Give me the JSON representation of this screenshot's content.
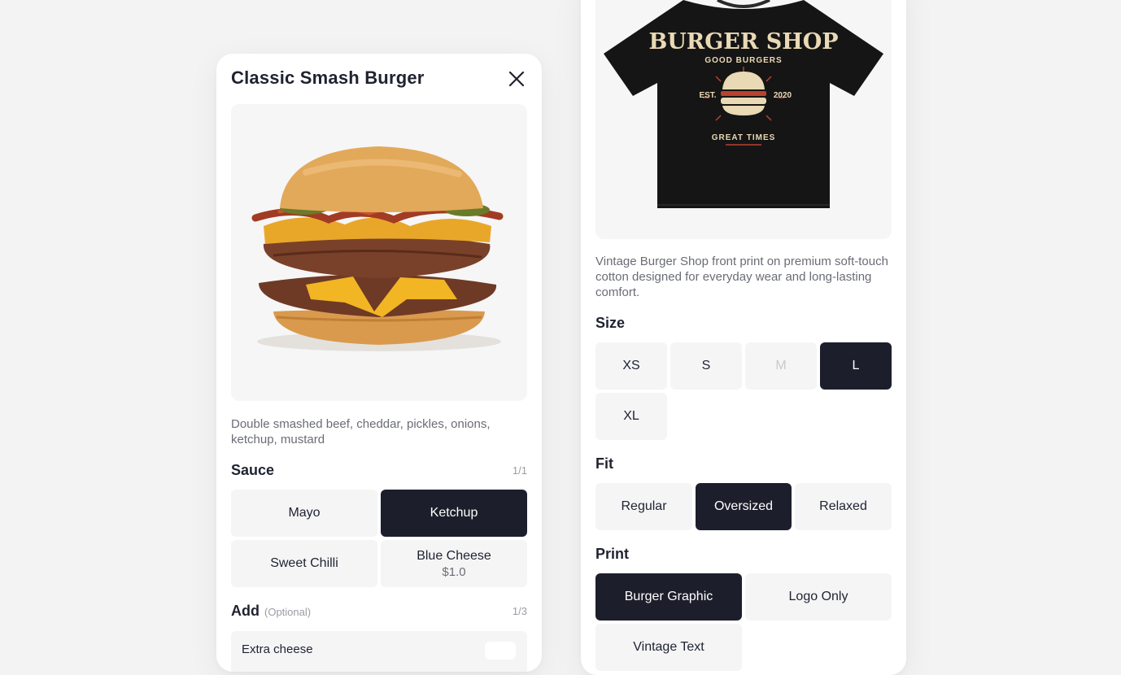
{
  "burger_modal": {
    "title": "Classic Smash Burger",
    "description": "Double smashed beef, cheddar, pickles, onions, ketchup, mustard",
    "sauce": {
      "label": "Sauce",
      "counter": "1/1",
      "options": [
        {
          "label": "Mayo",
          "price": "",
          "selected": false
        },
        {
          "label": "Ketchup",
          "price": "",
          "selected": true
        },
        {
          "label": "Sweet Chilli",
          "price": "",
          "selected": false
        },
        {
          "label": "Blue Cheese",
          "price": "$1.0",
          "selected": false
        }
      ]
    },
    "add": {
      "label": "Add",
      "optional": "(Optional)",
      "counter": "1/3",
      "first_item": "Extra cheese"
    }
  },
  "shirt_card": {
    "shirt_print": {
      "headline": "BURGER SHOP",
      "subline": "GOOD BURGERS",
      "est": "EST.",
      "year": "2020",
      "tagline": "GREAT TIMES"
    },
    "description": "Vintage Burger Shop front print on premium soft-touch cotton designed for everyday wear and long-lasting comfort.",
    "size": {
      "label": "Size",
      "options": [
        {
          "label": "XS",
          "state": "normal"
        },
        {
          "label": "S",
          "state": "normal"
        },
        {
          "label": "M",
          "state": "disabled"
        },
        {
          "label": "L",
          "state": "selected"
        },
        {
          "label": "XL",
          "state": "normal"
        }
      ]
    },
    "fit": {
      "label": "Fit",
      "options": [
        {
          "label": "Regular",
          "state": "normal"
        },
        {
          "label": "Oversized",
          "state": "selected"
        },
        {
          "label": "Relaxed",
          "state": "normal"
        }
      ]
    },
    "print": {
      "label": "Print",
      "options": [
        {
          "label": "Burger Graphic",
          "state": "selected"
        },
        {
          "label": "Logo Only",
          "state": "normal"
        },
        {
          "label": "Vintage Text",
          "state": "normal"
        }
      ]
    }
  },
  "colors": {
    "selected_bg": "#1c1f2b",
    "chip_bg": "#f5f5f6",
    "page_bg": "#f3f3f4",
    "print_cream": "#e9d9b4",
    "print_red": "#b9432e"
  },
  "icons": [
    "close-icon"
  ]
}
